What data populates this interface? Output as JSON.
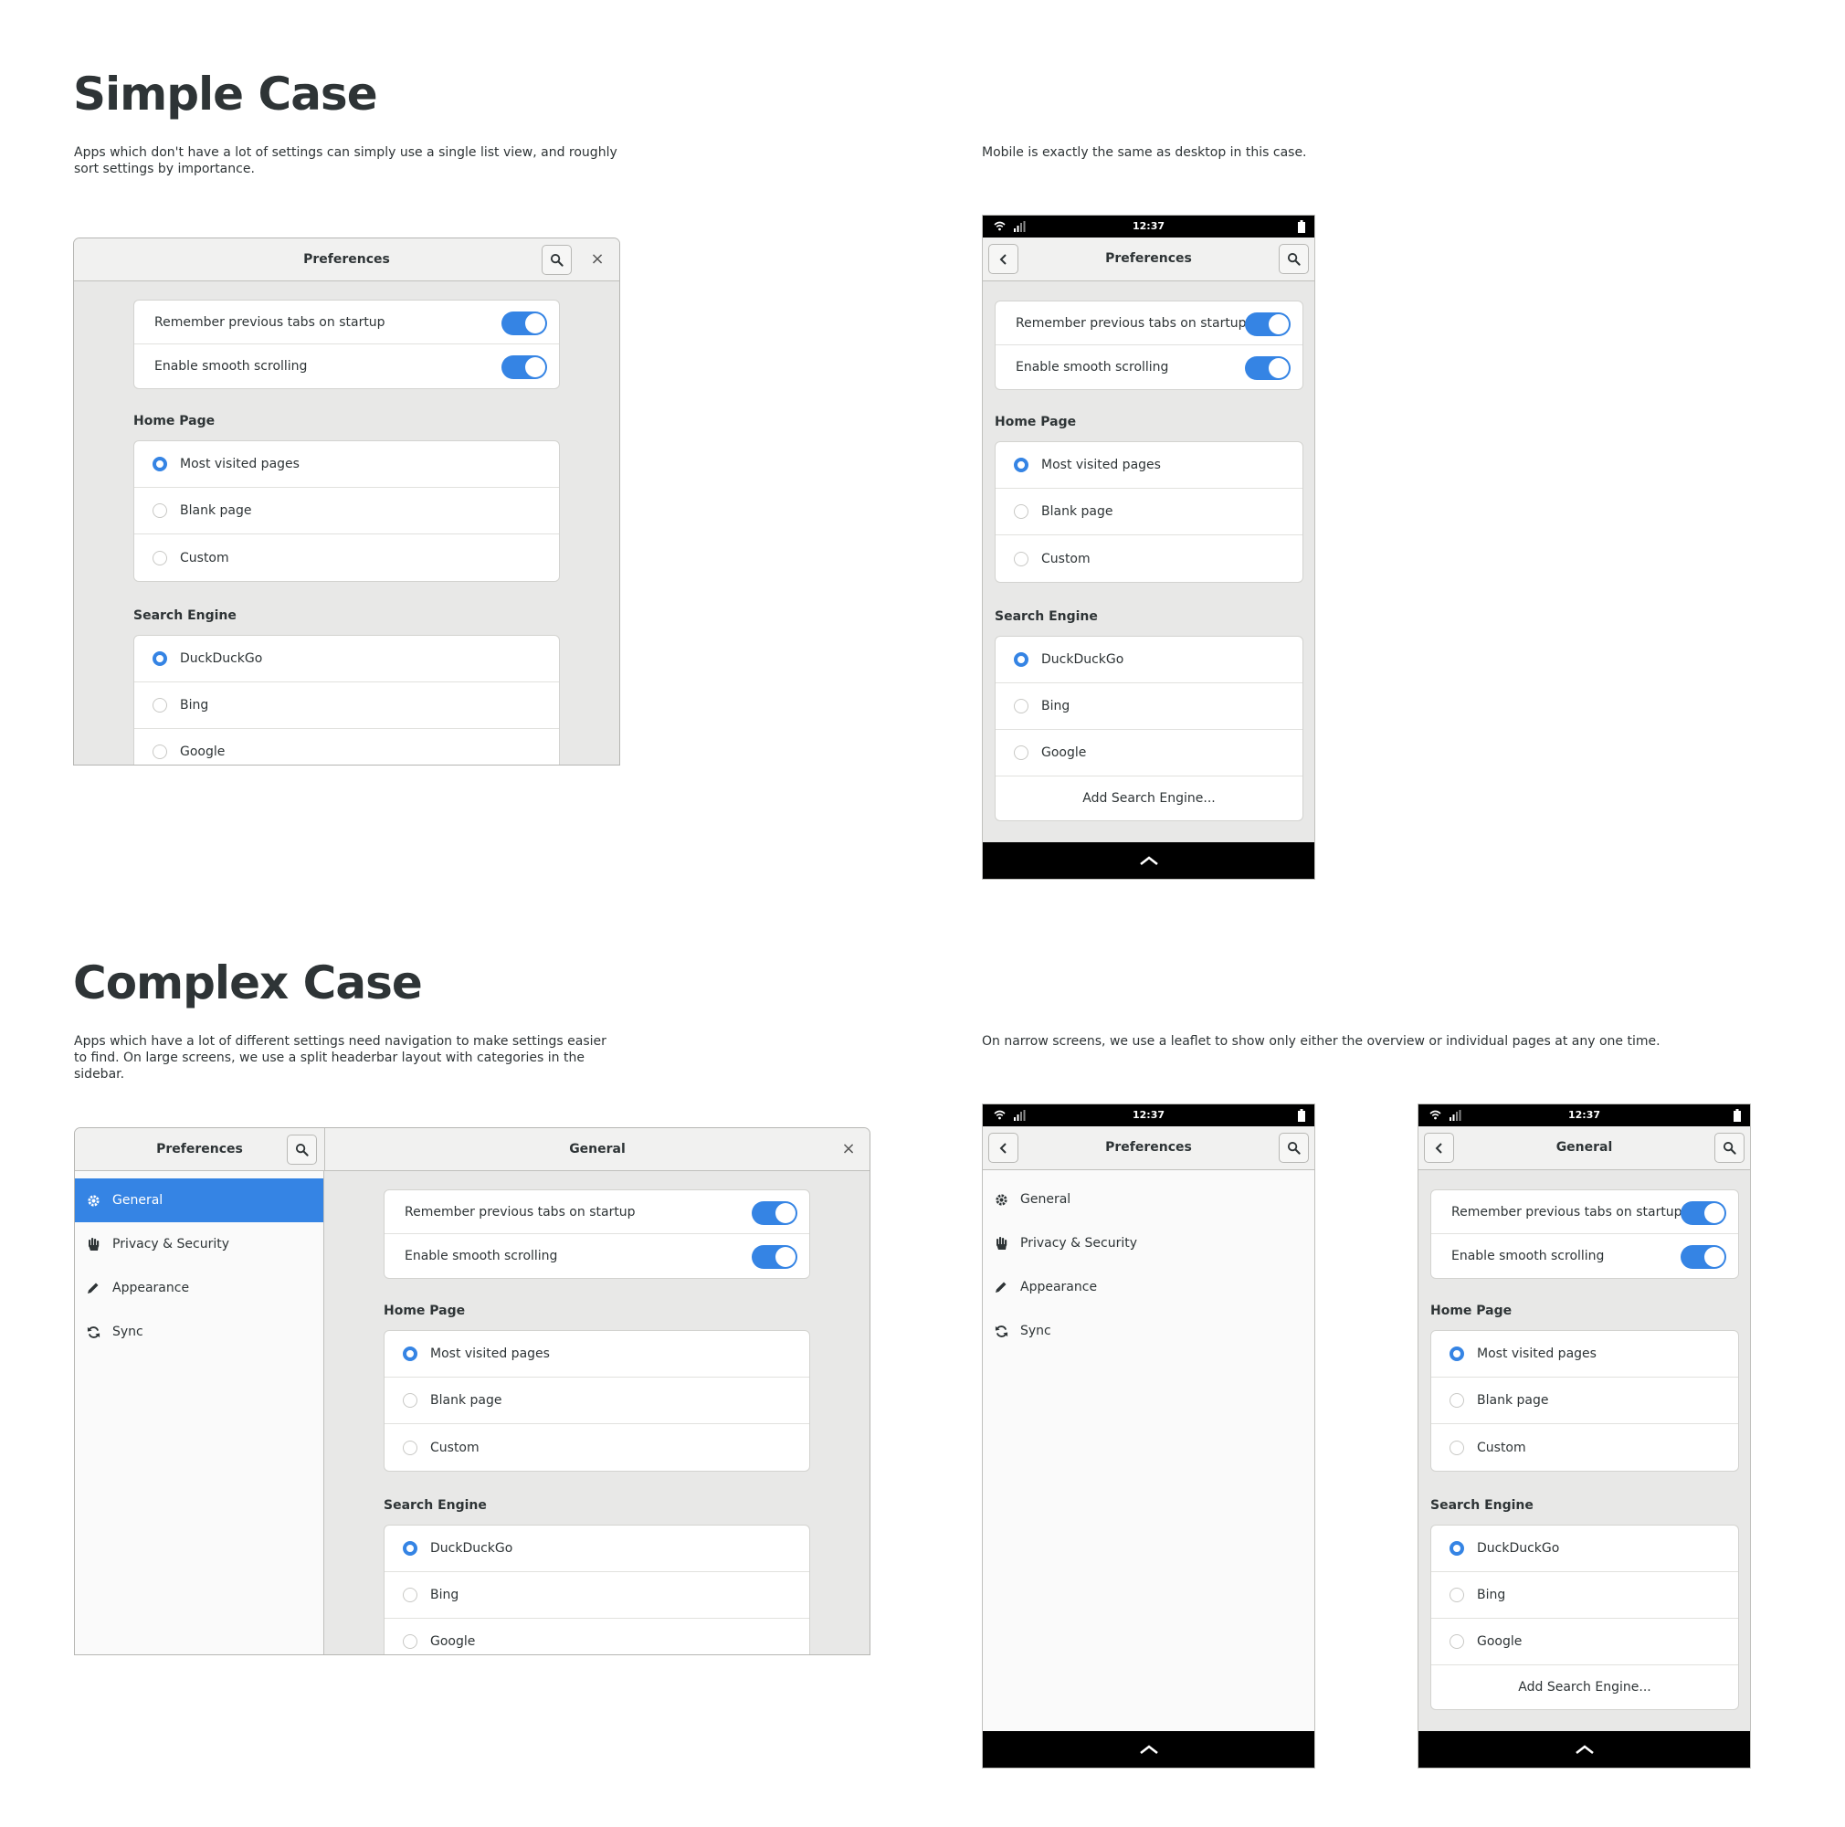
{
  "simple": {
    "heading": "Simple Case",
    "description": "Apps which don't have a lot of settings can simply use a single list view, and roughly sort settings by importance.",
    "mobile_note": "Mobile is exactly the same as desktop in this case."
  },
  "complex": {
    "heading": "Complex Case",
    "description": "Apps which have a lot of different settings need navigation to make settings easier to find. On large screens, we use a split headerbar layout with categories in the sidebar.",
    "mobile_note": "On narrow screens, we use a leaflet to show only either the overview or individual pages at any one time."
  },
  "window": {
    "title": "Preferences",
    "close_label": "×"
  },
  "status_bar": {
    "time": "12:37"
  },
  "toggles": [
    {
      "label": "Remember previous tabs on startup",
      "on": true
    },
    {
      "label": "Enable smooth scrolling",
      "on": true
    }
  ],
  "home_page": {
    "title": "Home Page",
    "options": [
      "Most visited pages",
      "Blank page",
      "Custom"
    ],
    "selected": "Most visited pages"
  },
  "search_engine": {
    "title": "Search Engine",
    "options": [
      "DuckDuckGo",
      "Bing",
      "Google"
    ],
    "selected": "DuckDuckGo",
    "add_label": "Add Search Engine..."
  },
  "sidebar": {
    "items": [
      {
        "label": "General",
        "icon": "gear-icon"
      },
      {
        "label": "Privacy & Security",
        "icon": "hand-icon"
      },
      {
        "label": "Appearance",
        "icon": "pencil-icon"
      },
      {
        "label": "Sync",
        "icon": "sync-icon"
      }
    ],
    "selected": "General"
  },
  "page_title": "General",
  "colors": {
    "accent": "#3584e4",
    "text": "#2e3436",
    "status_bar": "#000000"
  }
}
